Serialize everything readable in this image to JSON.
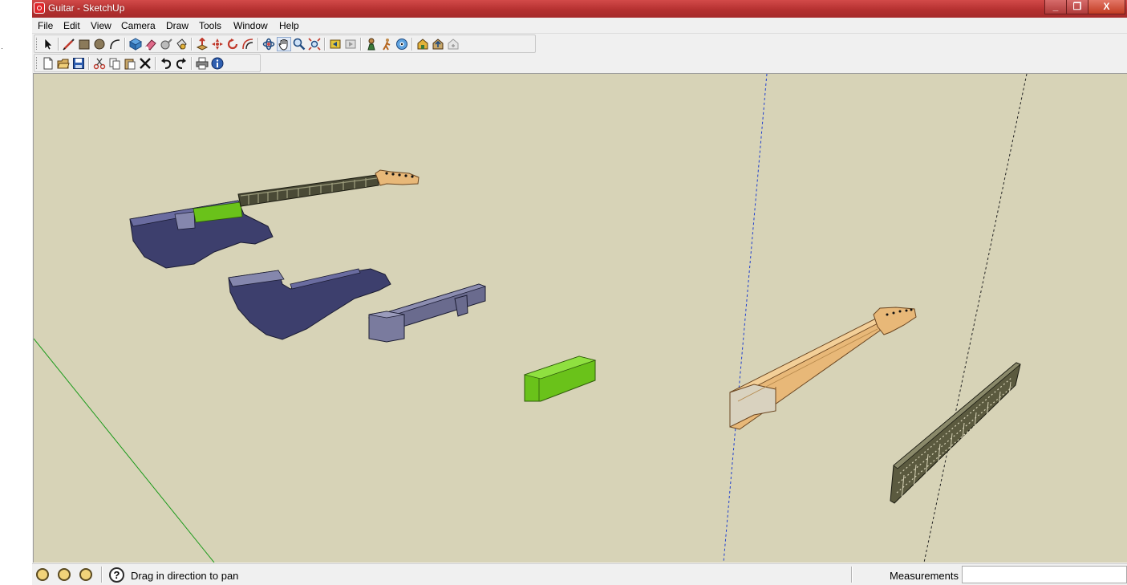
{
  "window": {
    "title": "Guitar - SketchUp"
  },
  "window_controls": {
    "minimize": "_",
    "maximize": "❐",
    "close": "X"
  },
  "menu": [
    "File",
    "Edit",
    "View",
    "Camera",
    "Draw",
    "Tools",
    "Window",
    "Help"
  ],
  "toolbar_large": [
    "select-icon",
    "line-pencil-icon",
    "rectangle-icon",
    "circle-icon",
    "arc-icon",
    "make-component-icon",
    "eraser-icon",
    "tape-measure-icon",
    "paint-bucket-icon",
    "push-pull-icon",
    "move-icon",
    "rotate-icon",
    "offset-icon",
    "orbit-icon",
    "pan-icon",
    "zoom-icon",
    "zoom-extents-icon",
    "previous-view-icon",
    "next-view-icon",
    "position-camera-icon",
    "walk-icon",
    "look-around-icon",
    "3d-warehouse-icon",
    "share-model-icon",
    "extension-warehouse-icon"
  ],
  "toolbar_standard": [
    "new-icon",
    "open-icon",
    "save-icon",
    "cut-icon",
    "copy-icon",
    "paste-icon",
    "delete-icon",
    "undo-icon",
    "redo-icon",
    "print-icon",
    "model-info-icon"
  ],
  "status": {
    "message": "Drag in direction to pan",
    "help": "?",
    "measurements_label": "Measurements",
    "measurements_value": ""
  },
  "colors": {
    "viewport_bg": "#d7d3b7",
    "body_blue": "#3d3f6d",
    "pickup_green": "#6ac21a",
    "neck_wood": "#e8b878",
    "axis_blue": "#1f3fcf",
    "axis_green": "#1a9a1a",
    "titlebar_red": "#b53130"
  }
}
